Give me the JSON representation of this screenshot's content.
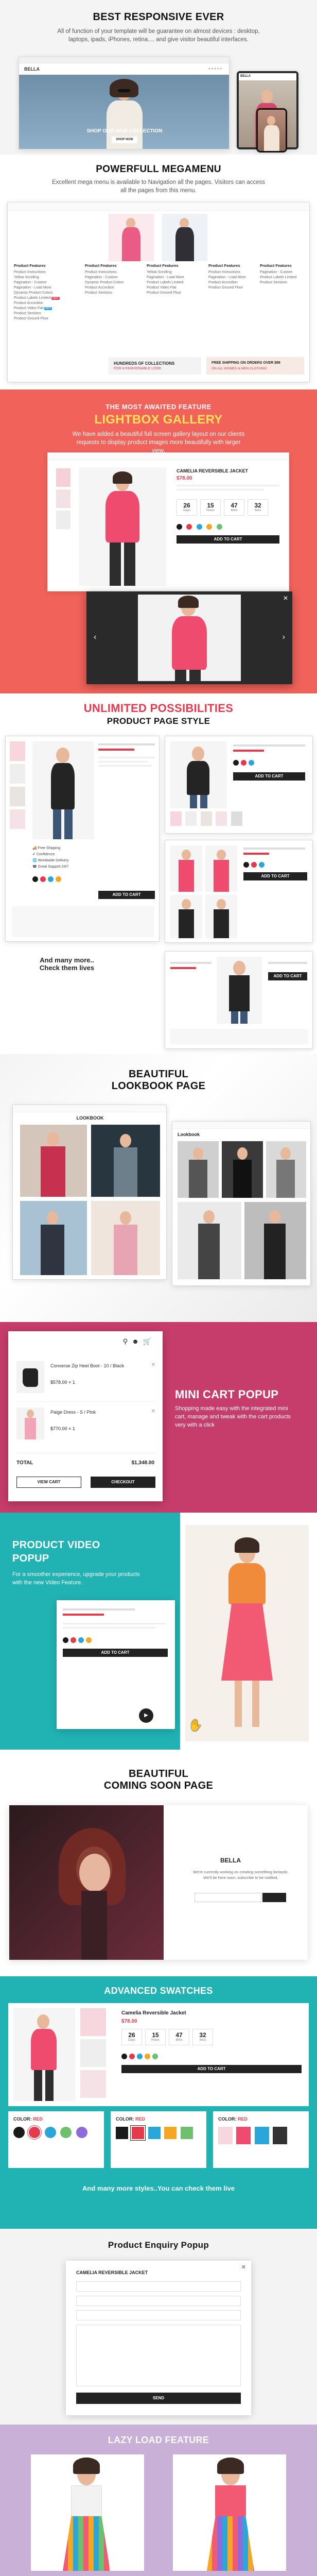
{
  "responsive": {
    "title": "BEST RESPONSIVE EVER",
    "description": "All of function of your template will be guarantee on almost devices : desktop, laptops, ipads, iPhones, retina.... and give visitor beautiful interfaces.",
    "brand": "BELLA",
    "hero_caption": "SHOP OUR NEW COLLECTION",
    "hero_button": "SHOP NOW"
  },
  "megamenu": {
    "title": "POWERFULL MEGAMENU",
    "description": "Excellent mega menu is available to Navigation all the pages. Visitors can access all the pages from this menu.",
    "column_title": "Product Features",
    "items": [
      "Product Instructions",
      "Yellow Scrolling",
      "Pagination - Custom",
      "Pagination - Load More",
      "Dynamic Product Colors",
      "Product Labels Limited",
      "Product Accordion",
      "Product Video Flat",
      "Product Sections",
      "Product Ground Floor"
    ],
    "banner1_a": "HUNDREDS OF COLLECTIONS",
    "banner1_b": "FOR A FASHIONABLE LOOK",
    "banner2_a": "FREE SHIPPING ON ORDERS OVER $99",
    "banner2_b": "ON ALL WOMEN & MEN CLOTHING"
  },
  "lightbox": {
    "kicker": "THE MOST AWAITED FEATURE",
    "title": "LIGHTBOX GALLERY",
    "description": "We have added a beautiful full screen gallery layout on our clients requests to display product images more beautifully with larger view.",
    "product_name": "CAMELIA REVERSIBLE JACKET",
    "price": "$78.00",
    "counter_days": "26",
    "counter_hours": "15",
    "counter_mins": "47",
    "counter_secs": "32",
    "label_days": "Days",
    "label_hours": "Hours",
    "label_mins": "Mins",
    "label_secs": "Secs"
  },
  "product_page": {
    "title_a": "UNLIMITED POSSIBILITIES",
    "title_b": "PRODUCT PAGE STYLE",
    "more_a": "And many more..",
    "more_b": "Check them lives",
    "feature1": "Free Shipping",
    "feature2": "Confidence",
    "feature3": "Worldwide Delivery",
    "feature4": "Great Support 24/7",
    "add_to_cart": "ADD TO CART"
  },
  "lookbook": {
    "title_a": "BEAUTIFUL",
    "title_b": "LOOKBOOK PAGE",
    "heading": "LOOKBOOK",
    "subheading": "Lookbook"
  },
  "mini_cart": {
    "title": "MINI CART POPUP",
    "description": "Shopping made easy with the integrated mini cart, manage and tweak with the cart products very with a click",
    "item1_name": "Converse Zip Heel Boot - 10 / Black",
    "item1_price": "$578.00",
    "item1_qty": "1",
    "item2_name": "Paige Dress - S / Pink",
    "item2_price": "$770.00",
    "item2_qty": "1",
    "total_label": "TOTAL",
    "total_value": "$1,348.00",
    "view_cart": "VIEW CART",
    "checkout": "CHECKOUT"
  },
  "video_popup": {
    "title_a": "PRODUCT VIDEO",
    "title_b": "POPUP",
    "description": "For a smoother experience, upgrade your products with the new Video Feature."
  },
  "coming_soon": {
    "title_a": "BEAUTIFUL",
    "title_b": "COMING SOON PAGE",
    "brand": "BELLA",
    "text": "We're currently working on creating something fantastic. We'll be here soon, subscribe to be notified."
  },
  "swatches": {
    "title": "ADVANCED SWATCHES",
    "product_name": "Camelia Reversible Jacket",
    "price": "$78.00",
    "color_label": "COLOR:",
    "color_value": "RED",
    "more": "And many more styles..You can check them live",
    "colors": [
      "#1a1a1a",
      "#e6394b",
      "#2aa7d8",
      "#f5a623",
      "#6ec06e",
      "#8e6bd8",
      "#ffffff"
    ]
  },
  "enquiry": {
    "title": "Product Enquiry Popup",
    "product_name": "CAMELIA REVERSIBLE JACKET",
    "submit": "SEND"
  },
  "lazy_load": {
    "title": "LAZY LOAD FEATURE"
  },
  "colors": {
    "accent_red": "#e6394b",
    "accent_teal": "#21b3b3",
    "accent_pink": "#e03c8a",
    "accent_purple": "#8e5aa8",
    "dark": "#222222"
  }
}
